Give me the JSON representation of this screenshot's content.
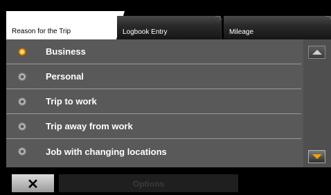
{
  "tabs": [
    {
      "label": "Reason for the Trip",
      "active": true
    },
    {
      "label": "Logbook Entry",
      "active": false
    },
    {
      "label": "Mileage",
      "active": false
    }
  ],
  "options": [
    {
      "label": "Business",
      "selected": true
    },
    {
      "label": "Personal",
      "selected": false
    },
    {
      "label": "Trip to work",
      "selected": false
    },
    {
      "label": "Trip away from work",
      "selected": false
    },
    {
      "label": "Job with changing locations",
      "selected": false
    }
  ],
  "bottom": {
    "close_label": "✕",
    "options_label": "Options"
  },
  "colors": {
    "accent": "#f5a000",
    "panel": "#595959",
    "background": "#000000"
  }
}
